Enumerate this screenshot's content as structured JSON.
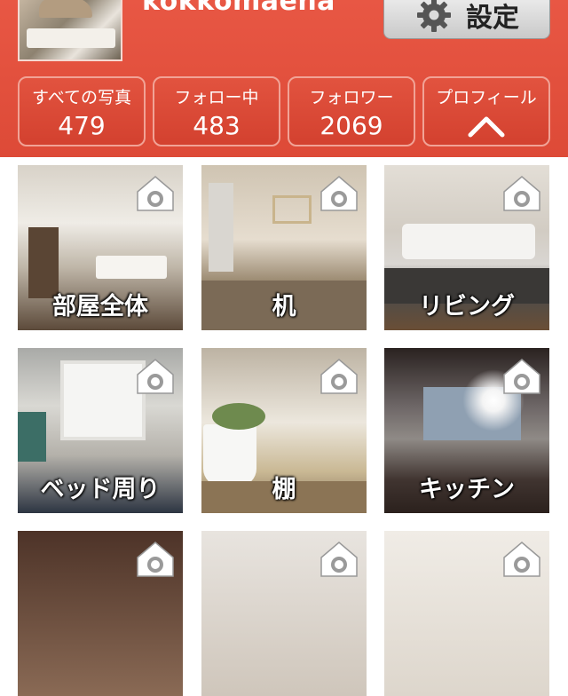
{
  "profile": {
    "username": "kokkomaena"
  },
  "settings": {
    "label": "設定",
    "icon": "gear-icon"
  },
  "stats": [
    {
      "label": "すべての写真",
      "value": "479"
    },
    {
      "label": "フォロー中",
      "value": "483"
    },
    {
      "label": "フォロワー",
      "value": "2069"
    }
  ],
  "profile_toggle": {
    "label": "プロフィール",
    "icon": "chevron-up-icon"
  },
  "tiles": [
    {
      "caption": "部屋全体"
    },
    {
      "caption": "机"
    },
    {
      "caption": "リビング"
    },
    {
      "caption": "ベッド周り"
    },
    {
      "caption": "棚"
    },
    {
      "caption": "キッチン"
    },
    {
      "caption": ""
    },
    {
      "caption": ""
    },
    {
      "caption": ""
    }
  ],
  "colors": {
    "header": "#e04f3c",
    "stat_button": "#d9483a",
    "settings_button": "#e0e0e0"
  }
}
